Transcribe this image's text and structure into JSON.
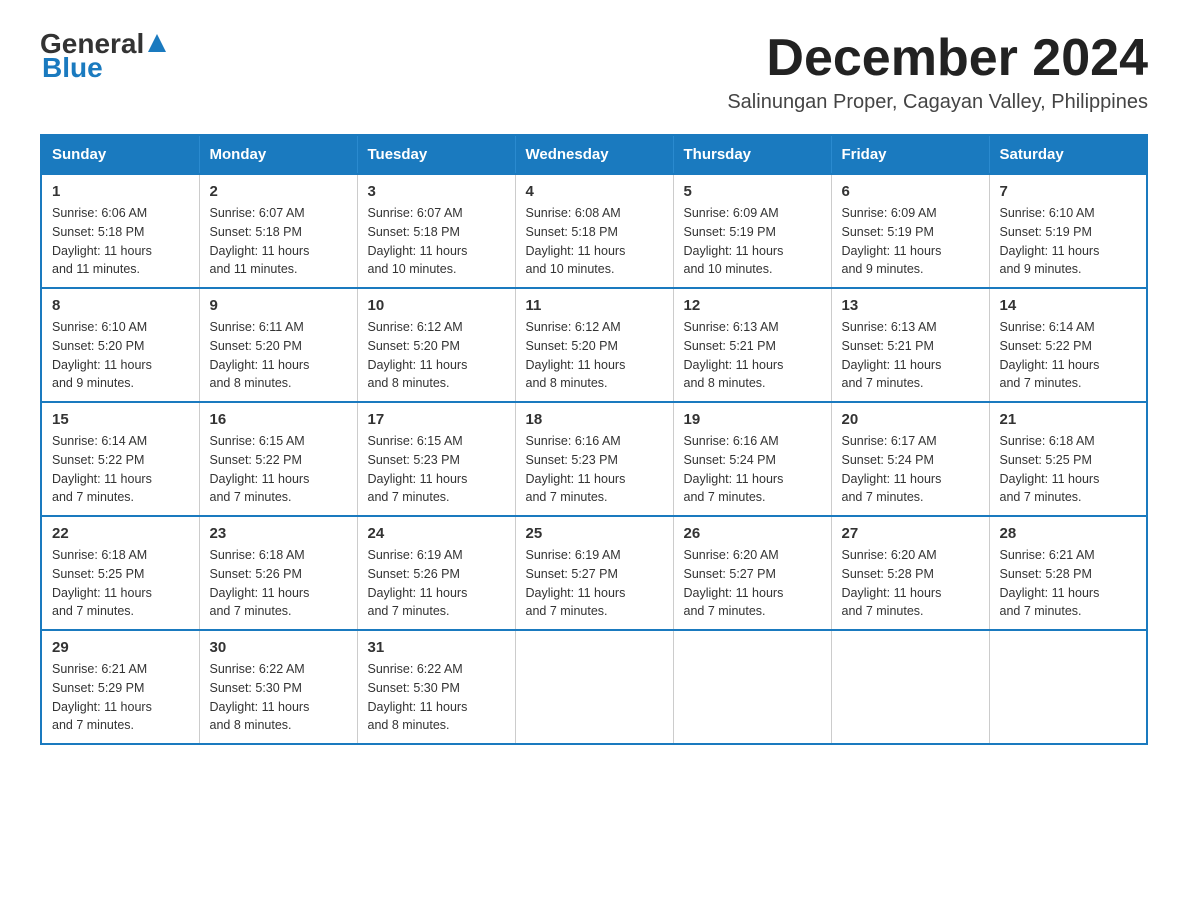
{
  "logo": {
    "general": "General",
    "blue": "Blue"
  },
  "title": "December 2024",
  "subtitle": "Salinungan Proper, Cagayan Valley, Philippines",
  "headers": [
    "Sunday",
    "Monday",
    "Tuesday",
    "Wednesday",
    "Thursday",
    "Friday",
    "Saturday"
  ],
  "weeks": [
    [
      {
        "day": "1",
        "info": "Sunrise: 6:06 AM\nSunset: 5:18 PM\nDaylight: 11 hours\nand 11 minutes."
      },
      {
        "day": "2",
        "info": "Sunrise: 6:07 AM\nSunset: 5:18 PM\nDaylight: 11 hours\nand 11 minutes."
      },
      {
        "day": "3",
        "info": "Sunrise: 6:07 AM\nSunset: 5:18 PM\nDaylight: 11 hours\nand 10 minutes."
      },
      {
        "day": "4",
        "info": "Sunrise: 6:08 AM\nSunset: 5:18 PM\nDaylight: 11 hours\nand 10 minutes."
      },
      {
        "day": "5",
        "info": "Sunrise: 6:09 AM\nSunset: 5:19 PM\nDaylight: 11 hours\nand 10 minutes."
      },
      {
        "day": "6",
        "info": "Sunrise: 6:09 AM\nSunset: 5:19 PM\nDaylight: 11 hours\nand 9 minutes."
      },
      {
        "day": "7",
        "info": "Sunrise: 6:10 AM\nSunset: 5:19 PM\nDaylight: 11 hours\nand 9 minutes."
      }
    ],
    [
      {
        "day": "8",
        "info": "Sunrise: 6:10 AM\nSunset: 5:20 PM\nDaylight: 11 hours\nand 9 minutes."
      },
      {
        "day": "9",
        "info": "Sunrise: 6:11 AM\nSunset: 5:20 PM\nDaylight: 11 hours\nand 8 minutes."
      },
      {
        "day": "10",
        "info": "Sunrise: 6:12 AM\nSunset: 5:20 PM\nDaylight: 11 hours\nand 8 minutes."
      },
      {
        "day": "11",
        "info": "Sunrise: 6:12 AM\nSunset: 5:20 PM\nDaylight: 11 hours\nand 8 minutes."
      },
      {
        "day": "12",
        "info": "Sunrise: 6:13 AM\nSunset: 5:21 PM\nDaylight: 11 hours\nand 8 minutes."
      },
      {
        "day": "13",
        "info": "Sunrise: 6:13 AM\nSunset: 5:21 PM\nDaylight: 11 hours\nand 7 minutes."
      },
      {
        "day": "14",
        "info": "Sunrise: 6:14 AM\nSunset: 5:22 PM\nDaylight: 11 hours\nand 7 minutes."
      }
    ],
    [
      {
        "day": "15",
        "info": "Sunrise: 6:14 AM\nSunset: 5:22 PM\nDaylight: 11 hours\nand 7 minutes."
      },
      {
        "day": "16",
        "info": "Sunrise: 6:15 AM\nSunset: 5:22 PM\nDaylight: 11 hours\nand 7 minutes."
      },
      {
        "day": "17",
        "info": "Sunrise: 6:15 AM\nSunset: 5:23 PM\nDaylight: 11 hours\nand 7 minutes."
      },
      {
        "day": "18",
        "info": "Sunrise: 6:16 AM\nSunset: 5:23 PM\nDaylight: 11 hours\nand 7 minutes."
      },
      {
        "day": "19",
        "info": "Sunrise: 6:16 AM\nSunset: 5:24 PM\nDaylight: 11 hours\nand 7 minutes."
      },
      {
        "day": "20",
        "info": "Sunrise: 6:17 AM\nSunset: 5:24 PM\nDaylight: 11 hours\nand 7 minutes."
      },
      {
        "day": "21",
        "info": "Sunrise: 6:18 AM\nSunset: 5:25 PM\nDaylight: 11 hours\nand 7 minutes."
      }
    ],
    [
      {
        "day": "22",
        "info": "Sunrise: 6:18 AM\nSunset: 5:25 PM\nDaylight: 11 hours\nand 7 minutes."
      },
      {
        "day": "23",
        "info": "Sunrise: 6:18 AM\nSunset: 5:26 PM\nDaylight: 11 hours\nand 7 minutes."
      },
      {
        "day": "24",
        "info": "Sunrise: 6:19 AM\nSunset: 5:26 PM\nDaylight: 11 hours\nand 7 minutes."
      },
      {
        "day": "25",
        "info": "Sunrise: 6:19 AM\nSunset: 5:27 PM\nDaylight: 11 hours\nand 7 minutes."
      },
      {
        "day": "26",
        "info": "Sunrise: 6:20 AM\nSunset: 5:27 PM\nDaylight: 11 hours\nand 7 minutes."
      },
      {
        "day": "27",
        "info": "Sunrise: 6:20 AM\nSunset: 5:28 PM\nDaylight: 11 hours\nand 7 minutes."
      },
      {
        "day": "28",
        "info": "Sunrise: 6:21 AM\nSunset: 5:28 PM\nDaylight: 11 hours\nand 7 minutes."
      }
    ],
    [
      {
        "day": "29",
        "info": "Sunrise: 6:21 AM\nSunset: 5:29 PM\nDaylight: 11 hours\nand 7 minutes."
      },
      {
        "day": "30",
        "info": "Sunrise: 6:22 AM\nSunset: 5:30 PM\nDaylight: 11 hours\nand 8 minutes."
      },
      {
        "day": "31",
        "info": "Sunrise: 6:22 AM\nSunset: 5:30 PM\nDaylight: 11 hours\nand 8 minutes."
      },
      {
        "day": "",
        "info": ""
      },
      {
        "day": "",
        "info": ""
      },
      {
        "day": "",
        "info": ""
      },
      {
        "day": "",
        "info": ""
      }
    ]
  ]
}
